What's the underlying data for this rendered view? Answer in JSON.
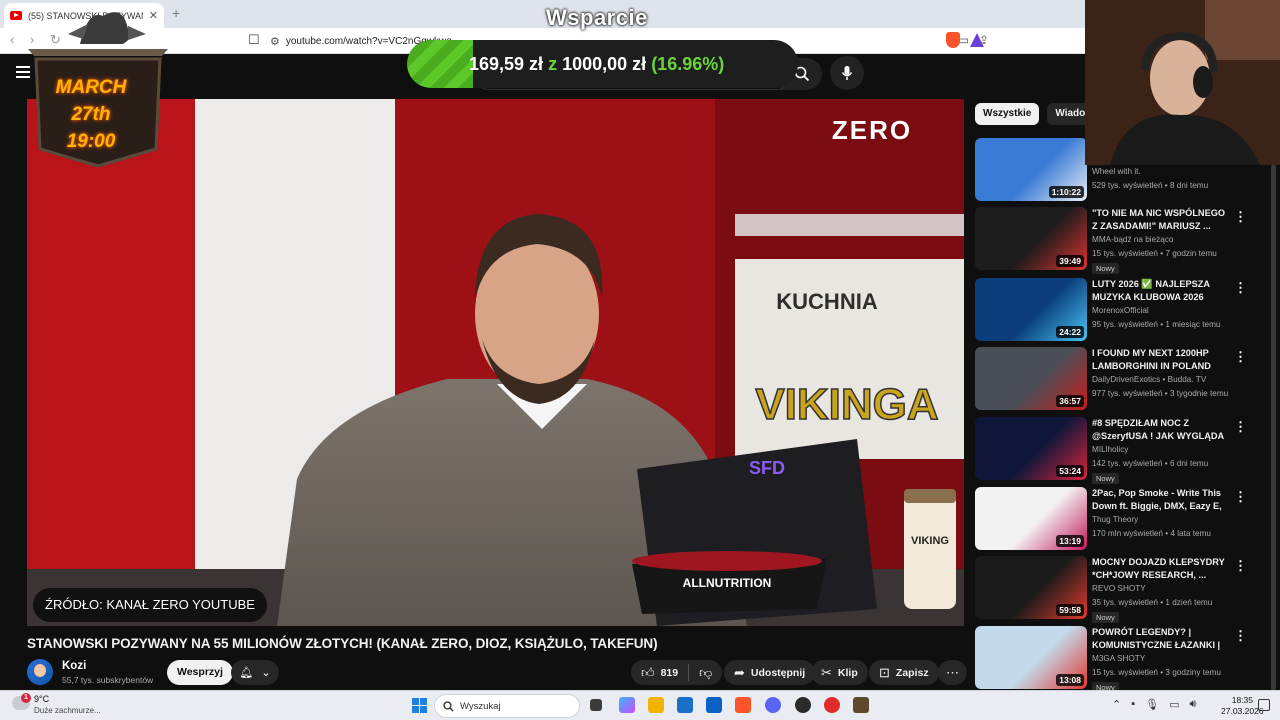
{
  "browser": {
    "tab_title": "(55) STANOWSKI POZYWANY NA 55...",
    "url": "youtube.com/watch?v=VC2nGqwkwo"
  },
  "overlay": {
    "wsparcie": "Wsparcie",
    "donation_current": "169,59 zł",
    "donation_z": "z",
    "donation_goal": "1000,00 zł",
    "donation_pct_text": "(16.96%)",
    "donation_fraction": 0.1696,
    "event_line1": "MARCH 27th",
    "event_line2": "19:00"
  },
  "video": {
    "source_chip": "ŹRÓDŁO: KANAŁ ZERO YOUTUBE",
    "title": "STANOWSKI POZYWANY NA 55 MILIONÓW ZŁOTYCH! (KANAŁ ZERO, DIOZ, KSIĄŻULO, TAKEFUN)",
    "channel": "Kozi",
    "subscribers": "55,7 tys. subskrybentów",
    "support_label": "Wesprzyj",
    "likes": "819",
    "share_label": "Udostępnij",
    "clip_label": "Klip",
    "save_label": "Zapisz",
    "scene_logo": "ZERO",
    "scene_sign": "VIKINGA",
    "scene_sign_top": "KUCHNIA",
    "scene_bowl": "ALLNUTRITION",
    "scene_laptop": "SFD",
    "scene_jar": "VIKING"
  },
  "chips": [
    "Wszystkie",
    "Wiadomości"
  ],
  "recommendations": [
    {
      "title": "",
      "channel": "Wheel with it.",
      "meta": "529 tys. wyświetleń • 8 dni temu",
      "duration": "1:10:22",
      "badge": "",
      "colors": [
        "#3a7bd5",
        "#e9eef5"
      ]
    },
    {
      "title": "\"TO NIE MA NIC WSPÓLNEGO Z ZASADAMI!\" MARIUSZ ...",
      "channel": "MMA-bądź na bieżąco",
      "meta": "15 tys. wyświetleń • 7 godzin temu",
      "duration": "39:49",
      "badge": "Nowy",
      "colors": [
        "#1c1c1c",
        "#d33"
      ]
    },
    {
      "title": "LUTY 2026 ✅ NAJLEPSZA MUZYKA KLUBOWA 2026 VOL...",
      "channel": "MorenoxOfficial",
      "meta": "95 tys. wyświetleń • 1 miesiąc temu",
      "duration": "24:22",
      "badge": "",
      "colors": [
        "#0a3d7a",
        "#49c3f5"
      ]
    },
    {
      "title": "I FOUND MY NEXT 1200HP LAMBORGHINI IN POLAND",
      "channel": "DailyDrivenExotics • Budda. TV",
      "meta": "977 tys. wyświetleń • 3 tygodnie temu",
      "duration": "36:57",
      "badge": "",
      "colors": [
        "#4a4f57",
        "#c81e1e"
      ]
    },
    {
      "title": "#8 SPĘDZIŁAM NOC Z @SzeryfUSA ! JAK WYGLĄDA ...",
      "channel": "MILlholicy",
      "meta": "142 tys. wyświetleń • 6 dni temu",
      "duration": "53:24",
      "badge": "Nowy",
      "colors": [
        "#10153a",
        "#d7263d"
      ]
    },
    {
      "title": "2Pac, Pop Smoke - Write This Down ft. Biggie, DMX, Eazy E, ...",
      "channel": "Thug Theory",
      "meta": "170 mln wyświetleń • 4 lata temu",
      "duration": "13:19",
      "badge": "",
      "colors": [
        "#f2f2f2",
        "#c2185b"
      ]
    },
    {
      "title": "MOCNY DOJAZD KLEPSYDRY *CH*JOWY RESEARCH, ...",
      "channel": "REVO SHOTY",
      "meta": "35 tys. wyświetleń • 1 dzień temu",
      "duration": "59:58",
      "badge": "Nowy",
      "colors": [
        "#1a1a1a",
        "#e23b2e"
      ]
    },
    {
      "title": "POWRÓT LEGENDY? | KOMUNISTYCZNE ŁAZANKI | ...",
      "channel": "M3GA SHOTY",
      "meta": "15 tys. wyświetleń • 3 godziny temu",
      "duration": "13:08",
      "badge": "Nowy",
      "colors": [
        "#c3d9ec",
        "#e0392f"
      ]
    }
  ],
  "taskbar": {
    "temperature": "9°C",
    "weather": "Duże zachmurze...",
    "weather_badge": "1",
    "search_placeholder": "Wyszukaj",
    "time": "18:35",
    "date": "27.03.2026"
  }
}
